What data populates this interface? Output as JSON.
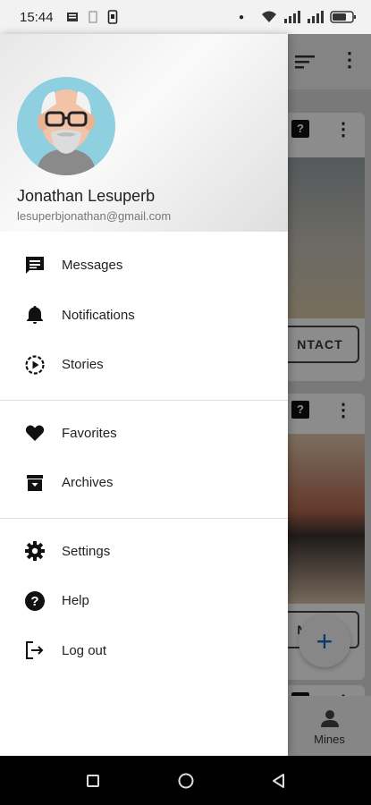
{
  "status_bar": {
    "time": "15:44"
  },
  "background": {
    "contact_label_1": "NTACT",
    "contact_label_2": "NTACT",
    "help_glyph": "?",
    "more_glyph": "⋮",
    "fab_glyph": "+",
    "bottom_nav_label": "Mines"
  },
  "drawer": {
    "user": {
      "name": "Jonathan Lesuperb",
      "email": "lesuperbjonathan@gmail.com"
    },
    "groups": [
      {
        "items": [
          {
            "label": "Messages",
            "icon": "message-icon"
          },
          {
            "label": "Notifications",
            "icon": "bell-icon"
          },
          {
            "label": "Stories",
            "icon": "stories-icon"
          }
        ]
      },
      {
        "items": [
          {
            "label": "Favorites",
            "icon": "heart-icon"
          },
          {
            "label": "Archives",
            "icon": "archive-icon"
          }
        ]
      },
      {
        "items": [
          {
            "label": "Settings",
            "icon": "gear-icon"
          },
          {
            "label": "Help",
            "icon": "help-icon"
          },
          {
            "label": "Log out",
            "icon": "logout-icon"
          }
        ]
      }
    ]
  }
}
